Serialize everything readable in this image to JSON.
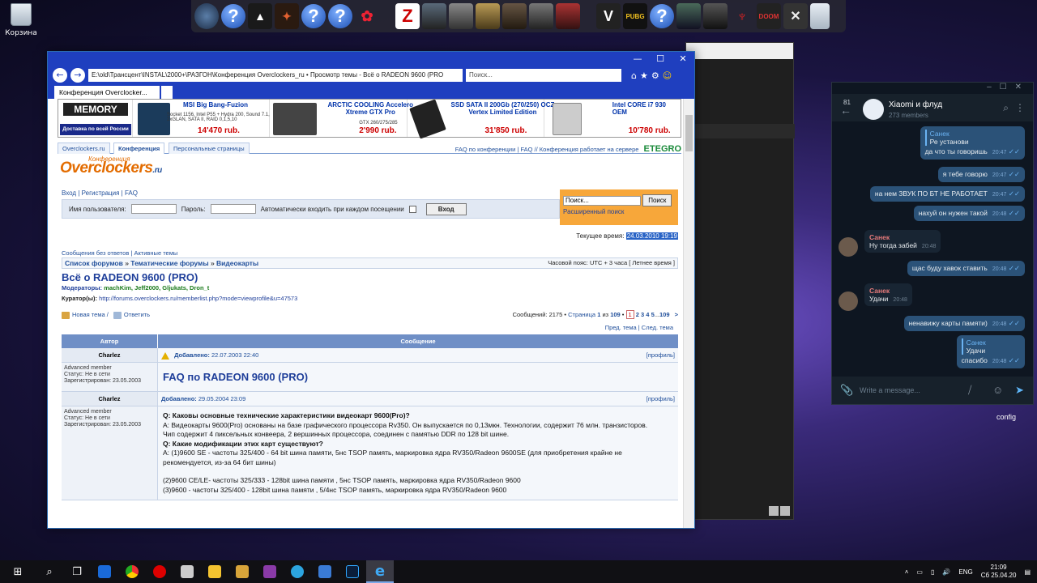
{
  "desktop": {
    "recycle_bin_label": "Корзина"
  },
  "dock": {
    "icons": [
      "cinema4d-icon",
      "question-icon",
      "assassins-creed-icon",
      "jedi-icon",
      "question-icon",
      "question-icon",
      "settings-icon",
      "z-icon",
      "ghost-recon-icon",
      "crysis-icon",
      "a-way-out-icon",
      "bioshock-icon",
      "call-of-duty-ww2-icon",
      "max-payne-icon",
      "v-icon",
      "pubg-lite-icon",
      "question-icon",
      "crysis2-icon",
      "call-of-duty-bo-icon",
      "assassin-icon",
      "doom-icon",
      "doom-eternal-icon",
      "recycle-icon"
    ],
    "labels": {
      "z": "Z",
      "doom": "DOOM",
      "pubg": "PUBG",
      "q": "?"
    }
  },
  "browser": {
    "address": "E:\\old\\Трансцент\\INSTAL\\2000+\\РАЗГОН\\Конференция Overclockers_ru • Просмотр темы - Всё о RADEON 9600 (PRO",
    "search_placeholder": "Поиск...",
    "tab_title": "Конференция Overclocker...",
    "window_title_hidden": "РАЗГОН"
  },
  "banner": {
    "memory_logo": "MEMORY",
    "delivery": "Доставка по всей России",
    "items": [
      {
        "title": "MSI Big Bang-Fuzion",
        "desc": "Socket 1156, Intel P55 + Hydra 200, Sound 7.1, 2xGLAN, SATA II, RAID 0,1,5,10",
        "price": "14'470 rub."
      },
      {
        "title": "ARCTIC COOLING Accelero Xtreme GTX Pro",
        "desc": "GTX 260/275/285",
        "price": "2'990 rub."
      },
      {
        "title": "SSD SATA II 200Gb (270/250) OCZ Vertex Limited Edition",
        "desc": "",
        "price": "31'850 rub."
      },
      {
        "title": "Intel CORE i7 930 OEM",
        "desc": "",
        "price": "10'780 rub."
      }
    ]
  },
  "site": {
    "tabs": [
      "Overclockers.ru",
      "Конференция",
      "Персональные страницы"
    ],
    "faq_link": "FAQ по конференции",
    "faq_short": "FAQ",
    "server_note": "// Конференция работает на сервере",
    "server_logo": "ETEGRO",
    "logo": "Overclockers",
    "logo_suffix": ".ru",
    "logo_top": "Конференция",
    "login_links": [
      "Вход",
      "Регистрация",
      "FAQ"
    ],
    "username_label": "Имя пользователя:",
    "password_label": "Пароль:",
    "autologin_label": "Автоматически входить при каждом посещении",
    "login_button": "Вход",
    "search_value": "Поиск...",
    "search_button": "Поиск",
    "adv_search": "Расширенный поиск",
    "current_time_label": "Текущее время:",
    "current_time": "24.03.2010 19:19",
    "quick_links": [
      "Сообщения без ответов",
      "Активные темы"
    ],
    "breadcrumbs": [
      "Список форумов",
      "Тематические форумы",
      "Видеокарты"
    ],
    "timezone": "Часовой пояс: UTC + 3 часа [ Летнее время ]",
    "topic_title": "Всё о RADEON 9600 (PRO)",
    "moderators_label": "Модераторы:",
    "moderators": "machKim, Jeff2000, Gljukats, Dron_t",
    "curator_label": "Куратор(ы):",
    "curator_url": "http://forums.overclockers.ru/memberlist.php?mode=viewprofile&u=47573",
    "new_topic": "Новая тема",
    "reply": "Ответить",
    "messages_count": "Сообщений: 2175 •",
    "page_word": "Страница",
    "page_current": "1",
    "page_of": "из",
    "page_total": "109",
    "pages": [
      "1",
      "2",
      "3",
      "4",
      "5",
      "...",
      "109"
    ],
    "next_arrow": ">",
    "prev_topic": "Пред. тема",
    "next_topic": "След. тема",
    "col_author": "Автор",
    "col_message": "Сообщение"
  },
  "posts": [
    {
      "author": "Charlez",
      "rank": "Advanced member",
      "status": "Статус: Не в сети",
      "registered": "Зарегистрирован: 23.05.2003",
      "posted_label": "Добавлено:",
      "posted": "22.07.2003 22:40",
      "profile": "[профиль]",
      "title": "FAQ по RADEON 9600 (PRO)"
    },
    {
      "author": "Charlez",
      "rank": "Advanced member",
      "status": "Статус: Не в сети",
      "registered": "Зарегистрирован: 23.05.2003",
      "posted_label": "Добавлено:",
      "posted": "29.05.2004 23:09",
      "profile": "[профиль]",
      "lines": [
        "Q: Каковы основные технические характеристики видеокарт 9600(Pro)?",
        "A: Видеокарты 9600(Pro) основаны на базе графического процессора Rv350. Он выпускается по 0,13мкн. Технологии, содержит 76 млн. транзисторов.",
        "Чип содержит 4 пиксельных конвеера, 2 вершинных процессора, соединен с памятью DDR по 128 bit шине.",
        "Q: Какие модификации этих карт существуют?",
        "A: (1)9600 SE - частоты 325/400 - 64 bit шина памяти, 5нс TSOP память, маркировка ядра RV350/Radeon 9600SE (для приобретения крайне не рекомендуется, из-за 64 бит шины)",
        "(2)9600 CE/LE- частоты 325/333 - 128bit шина памяти , 5нс TSOP память, маркировка ядра RV350/Radeon 9600",
        "(3)9600 - частоты 325/400 - 128bit шина памяти , 5/4нс TSOP память, маркировка ядра RV350/Radeon 9600"
      ]
    }
  ],
  "telegram": {
    "unread": "81",
    "title": "Xiaomi и флуд",
    "members": "273 members",
    "input_placeholder": "Write a message...",
    "messages": [
      {
        "dir": "out",
        "reply_to": "Санек",
        "reply_text": "Ре установи",
        "text": "да что ты говоришь",
        "time": "20:47"
      },
      {
        "dir": "out",
        "text": "я тебе говорю",
        "time": "20:47"
      },
      {
        "dir": "out",
        "text": "на нем ЗВУК ПО БТ НЕ РАБОТАЕТ",
        "time": "20:47"
      },
      {
        "dir": "out",
        "text": "нахуй он нужен такой",
        "time": "20:48"
      },
      {
        "dir": "in",
        "sender": "Санек",
        "text": "Ну тогда забей",
        "time": "20:48"
      },
      {
        "dir": "out",
        "text": "щас буду хавок ставить",
        "time": "20:48"
      },
      {
        "dir": "in",
        "sender": "Санек",
        "text": "Удачи",
        "time": "20:48"
      },
      {
        "dir": "out",
        "text": "ненавижу карты памяти)",
        "time": "20:48"
      },
      {
        "dir": "out",
        "reply_to": "Санек",
        "reply_text": "Удачи",
        "text": "спасибо",
        "time": "20:48"
      }
    ]
  },
  "desktop_label": "config",
  "taskbar": {
    "lang": "ENG",
    "time": "21:09",
    "date": "Сб 25.04.20"
  }
}
